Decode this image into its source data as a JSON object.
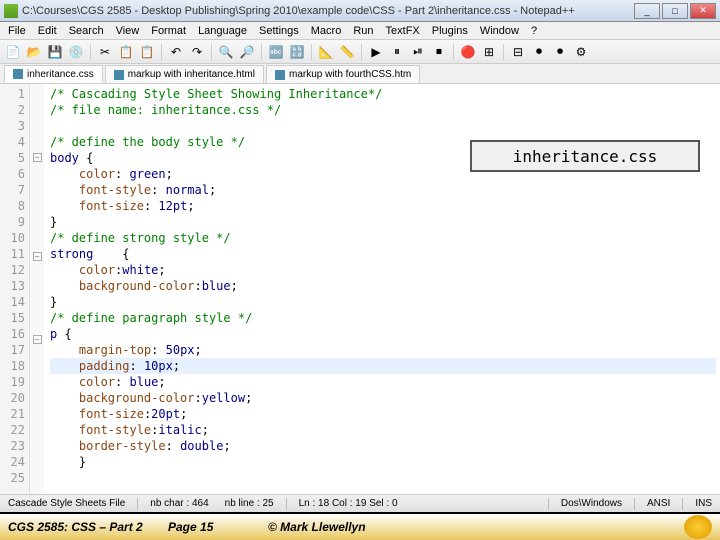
{
  "titlebar": {
    "text": "C:\\Courses\\CGS 2585 - Desktop Publishing\\Spring 2010\\example code\\CSS - Part 2\\inheritance.css - Notepad++"
  },
  "winButtons": {
    "min": "_",
    "max": "□",
    "close": "✕"
  },
  "menu": [
    "File",
    "Edit",
    "Search",
    "View",
    "Format",
    "Language",
    "Settings",
    "Macro",
    "Run",
    "TextFX",
    "Plugins",
    "Window",
    "?"
  ],
  "toolbarIcons": [
    "📄",
    "📂",
    "💾",
    "💿",
    "✂",
    "📋",
    "📋",
    "↶",
    "↷",
    "🔍",
    "🔎",
    "🔤",
    "🔡",
    "📐",
    "📏",
    "▶",
    "⏸",
    "⏯",
    "⏹",
    "🔴",
    "⊞",
    "⊟",
    "⏺",
    "⏺",
    "⚙"
  ],
  "tabs": [
    {
      "label": "inheritance.css",
      "active": true
    },
    {
      "label": "markup with inheritance.html",
      "active": false
    },
    {
      "label": "markup with fourthCSS.htm",
      "active": false
    }
  ],
  "code": {
    "lines": [
      {
        "n": "1",
        "cls": "c-comment",
        "text": "/* Cascading Style Sheet Showing Inheritance*/"
      },
      {
        "n": "2",
        "cls": "c-comment",
        "text": "/* file name: inheritance.css */"
      },
      {
        "n": "3",
        "text": ""
      },
      {
        "n": "4",
        "cls": "c-comment",
        "text": "/* define the body style */"
      },
      {
        "n": "5",
        "fold": "⊟",
        "html": "<span class='c-tag'>body</span> <span class='c-punct'>{</span>"
      },
      {
        "n": "6",
        "html": "    <span class='c-prop'>color</span><span class='c-punct'>:</span> <span class='c-val'>green</span><span class='c-punct'>;</span>"
      },
      {
        "n": "7",
        "html": "    <span class='c-prop'>font-style</span><span class='c-punct'>:</span> <span class='c-val'>normal</span><span class='c-punct'>;</span>"
      },
      {
        "n": "8",
        "html": "    <span class='c-prop'>font-size</span><span class='c-punct'>:</span> <span class='c-val'>12pt</span><span class='c-punct'>;</span>"
      },
      {
        "n": "9",
        "html": "<span class='c-punct'>}</span>"
      },
      {
        "n": "10",
        "cls": "c-comment",
        "text": "/* define strong style */"
      },
      {
        "n": "11",
        "fold": "⊟",
        "html": "<span class='c-tag'>strong</span>    <span class='c-punct'>{</span>"
      },
      {
        "n": "12",
        "html": "    <span class='c-prop'>color</span><span class='c-punct'>:</span><span class='c-val'>white</span><span class='c-punct'>;</span>"
      },
      {
        "n": "13",
        "html": "    <span class='c-prop'>background-color</span><span class='c-punct'>:</span><span class='c-val'>blue</span><span class='c-punct'>;</span>"
      },
      {
        "n": "14",
        "html": "<span class='c-punct'>}</span>"
      },
      {
        "n": "15",
        "cls": "c-comment",
        "text": "/* define paragraph style */"
      },
      {
        "n": "16",
        "fold": "⊟",
        "html": "<span class='c-tag'>p</span> <span class='c-punct'>{</span>"
      },
      {
        "n": "17",
        "html": "    <span class='c-prop'>margin-top</span><span class='c-punct'>:</span> <span class='c-val'>50px</span><span class='c-punct'>;</span>"
      },
      {
        "n": "18",
        "hl": true,
        "html": "    <span class='c-prop'>padding</span><span class='c-punct'>:</span> <span class='c-val'>10px</span><span class='c-punct'>;</span>"
      },
      {
        "n": "19",
        "html": "    <span class='c-prop'>color</span><span class='c-punct'>:</span> <span class='c-val'>blue</span><span class='c-punct'>;</span>"
      },
      {
        "n": "20",
        "html": "    <span class='c-prop'>background-color</span><span class='c-punct'>:</span><span class='c-val'>yellow</span><span class='c-punct'>;</span>"
      },
      {
        "n": "21",
        "html": "    <span class='c-prop'>font-size</span><span class='c-punct'>:</span><span class='c-val'>20pt</span><span class='c-punct'>;</span>"
      },
      {
        "n": "22",
        "html": "    <span class='c-prop'>font-style</span><span class='c-punct'>:</span><span class='c-val'>italic</span><span class='c-punct'>;</span>"
      },
      {
        "n": "23",
        "html": "    <span class='c-prop'>border-style</span><span class='c-punct'>:</span> <span class='c-val'>double</span><span class='c-punct'>;</span>"
      },
      {
        "n": "24",
        "html": "    <span class='c-punct'>}</span>"
      },
      {
        "n": "25",
        "text": ""
      }
    ]
  },
  "annotation": "inheritance.css",
  "status": {
    "lang": "Cascade Style Sheets File",
    "chars": "nb char : 464",
    "lines": "nb line : 25",
    "pos": "Ln : 18  Col : 19  Sel : 0",
    "eol": "Dos\\Windows",
    "enc": "ANSI",
    "ins": "INS"
  },
  "footer": {
    "left": "CGS 2585: CSS – Part 2",
    "page": "Page 15",
    "copy": "© Mark Llewellyn"
  }
}
